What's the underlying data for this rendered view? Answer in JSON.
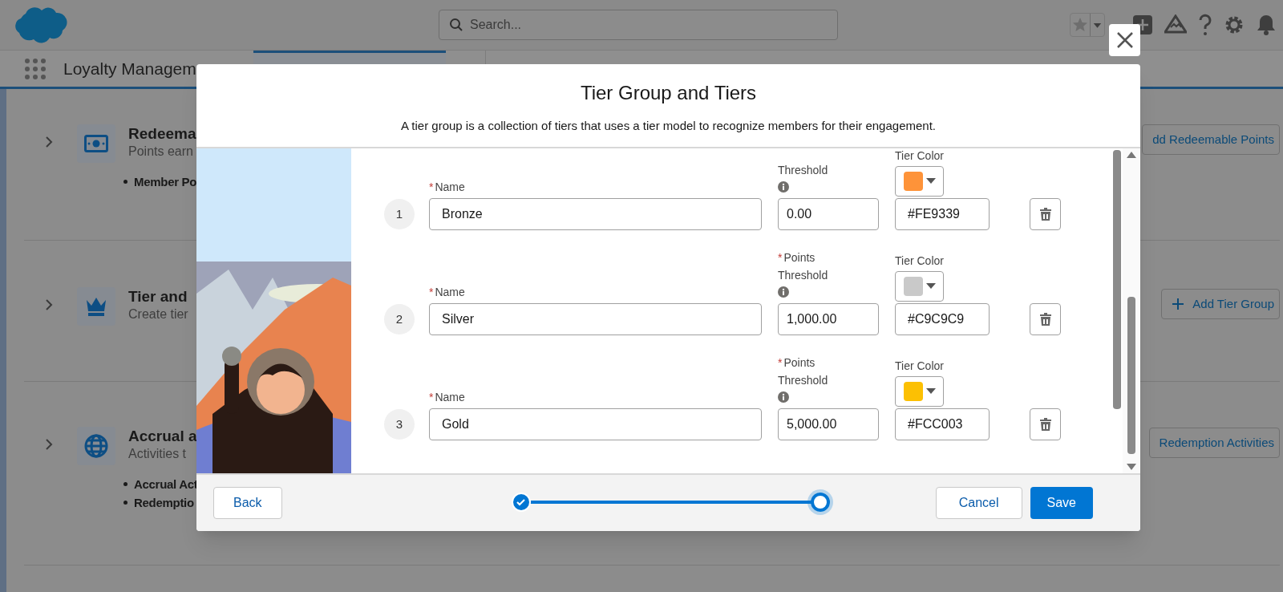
{
  "header": {
    "search": {
      "placeholder": "Search..."
    }
  },
  "nav": {
    "app_name": "Loyalty Managem",
    "tabs": [
      {
        "selected": true
      }
    ]
  },
  "sections": [
    {
      "kind": "money",
      "title": "Redeema",
      "subtitle": "Points earn",
      "bullets": [
        "Member Po"
      ],
      "action": {
        "kind": "plain",
        "label": "dd Redeemable Points"
      }
    },
    {
      "kind": "crown",
      "title": "Tier and",
      "subtitle": "Create tier",
      "action": {
        "kind": "plus",
        "label": "Add Tier Group"
      }
    },
    {
      "kind": "globe",
      "title": "Accrual a",
      "subtitle": "Activities t",
      "bullets": [
        "Accrual Act",
        "Redemptio"
      ],
      "action": {
        "kind": "plain",
        "label": "Redemption Activities"
      }
    }
  ],
  "modal": {
    "title": "Tier Group and Tiers",
    "description": "A tier group is a collection of tiers that uses a tier model to recognize members for their engagement.",
    "tiers": [
      {
        "number": "1",
        "name_required_mark": "*",
        "name_label": "Name",
        "name": "Bronze",
        "threshold_label": [
          "Threshold"
        ],
        "threshold": "0.00",
        "color_label": "Tier Color",
        "color": "#fe9339",
        "hex": "#FE9339"
      },
      {
        "number": "2",
        "name_required_mark": "*",
        "name_label": "Name",
        "name": "Silver",
        "threshold_required_mark": "*",
        "threshold_label": [
          "Points",
          "Threshold"
        ],
        "threshold": "1,000.00",
        "color_label": "Tier Color",
        "color": "#c9c9c9",
        "hex": "#C9C9C9"
      },
      {
        "number": "3",
        "name_required_mark": "*",
        "name_label": "Name",
        "name": "Gold",
        "threshold_required_mark": "*",
        "threshold_label": [
          "Points",
          "Threshold"
        ],
        "threshold": "5,000.00",
        "color_label": "Tier Color",
        "color": "#fcc003",
        "hex": "#FCC003"
      }
    ],
    "footer": {
      "back": "Back",
      "steps": [
        {
          "completed": true,
          "selected": false
        },
        {
          "completed": false,
          "selected": true
        }
      ],
      "cancel": "Cancel",
      "save": "Save"
    }
  }
}
